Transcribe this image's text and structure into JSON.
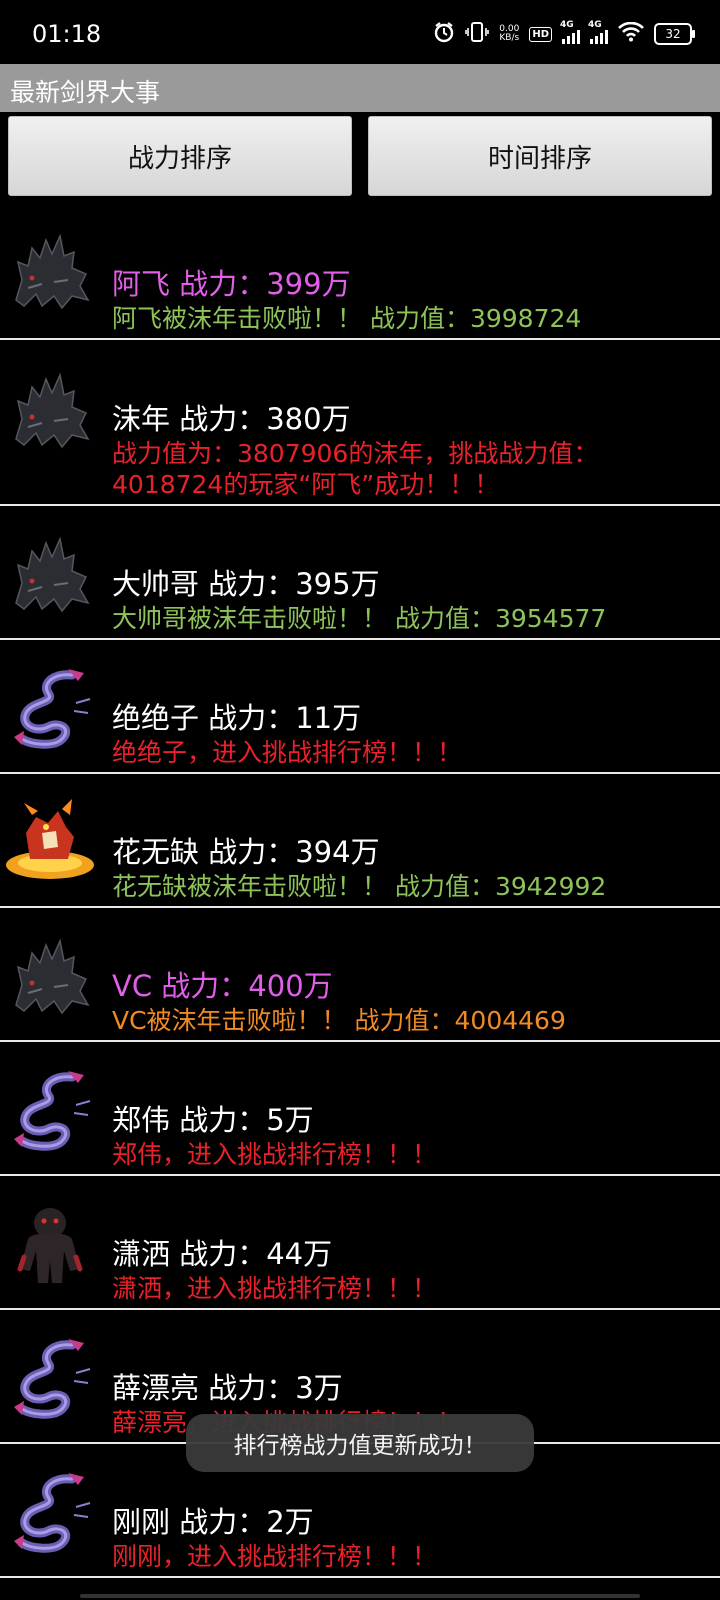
{
  "status_bar": {
    "time": "01:18",
    "net_speed_value": "0.00",
    "net_speed_unit": "KB/s",
    "hd_label": "HD",
    "sim1": "4G",
    "sim2": "4G",
    "battery": "32"
  },
  "title_bar": {
    "title": "最新剑界大事"
  },
  "sort_buttons": {
    "power_sort": "战力排序",
    "time_sort": "时间排序"
  },
  "colors": {
    "magenta": "#e15ee8",
    "white": "#ffffff",
    "green": "#8ec35a",
    "red": "#e8222a",
    "orange": "#f08a24"
  },
  "list": [
    {
      "avatar": "dark-beast-icon",
      "name": "阿飞 战力：399万",
      "name_color": "#e15ee8",
      "message": [
        "阿飞被沫年击败啦！！ 战力值：3998724"
      ],
      "message_color": "#8ec35a"
    },
    {
      "avatar": "dark-beast-icon",
      "name": "沫年 战力：380万",
      "name_color": "#ffffff",
      "message": [
        "战力值为：3807906的沫年，挑战战力值：",
        "4018724的玩家“阿飞”成功！！！"
      ],
      "message_color": "#e8222a"
    },
    {
      "avatar": "dark-beast-icon",
      "name": "大帅哥 战力：395万",
      "name_color": "#ffffff",
      "message": [
        "大帅哥被沫年击败啦！！ 战力值：3954577"
      ],
      "message_color": "#8ec35a"
    },
    {
      "avatar": "purple-dragon-icon",
      "name": "绝绝子 战力：11万",
      "name_color": "#ffffff",
      "message": [
        "绝绝子，进入挑战排行榜！！！"
      ],
      "message_color": "#e8222a"
    },
    {
      "avatar": "fire-beast-icon",
      "name": "花无缺 战力：394万",
      "name_color": "#ffffff",
      "message": [
        "花无缺被沫年击败啦！！ 战力值：3942992"
      ],
      "message_color": "#8ec35a"
    },
    {
      "avatar": "dark-beast-icon",
      "name": "VC 战力：400万",
      "name_color": "#e15ee8",
      "message": [
        "VC被沫年击败啦！！ 战力值：4004469"
      ],
      "message_color": "#f08a24"
    },
    {
      "avatar": "purple-dragon-icon",
      "name": "郑伟 战力：5万",
      "name_color": "#ffffff",
      "message": [
        "郑伟，进入挑战排行榜！！！"
      ],
      "message_color": "#e8222a"
    },
    {
      "avatar": "shadow-golem-icon",
      "name": "潇洒 战力：44万",
      "name_color": "#ffffff",
      "message": [
        "潇洒，进入挑战排行榜！！！"
      ],
      "message_color": "#e8222a"
    },
    {
      "avatar": "purple-dragon-icon",
      "name": "薛漂亮 战力：3万",
      "name_color": "#ffffff",
      "message": [
        "薛漂亮，进入挑战排行榜！！！"
      ],
      "message_color": "#e8222a"
    },
    {
      "avatar": "purple-dragon-icon",
      "name": "刚刚 战力：2万",
      "name_color": "#ffffff",
      "message": [
        "刚刚，进入挑战排行榜！！！"
      ],
      "message_color": "#e8222a"
    }
  ],
  "toast": {
    "text": "排行榜战力值更新成功！"
  }
}
